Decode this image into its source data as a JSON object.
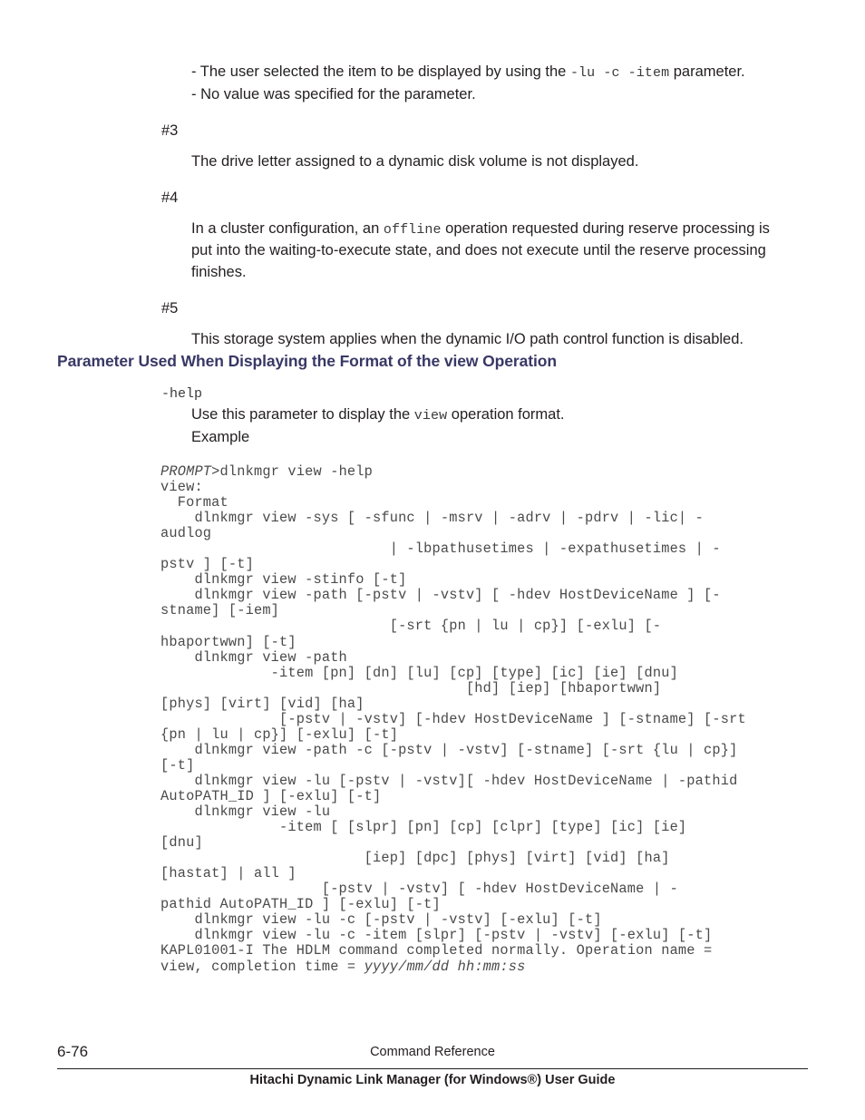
{
  "document": {
    "notes": [
      {
        "type": "bullet-group",
        "lines": [
          {
            "segments": [
              {
                "text": "- The user selected the item to be displayed by using the ",
                "mono": false
              },
              {
                "text": "-lu -c -item",
                "mono": true
              },
              {
                "text": " parameter.",
                "mono": false
              }
            ]
          },
          {
            "segments": [
              {
                "text": "- No value was specified for the parameter.",
                "mono": false
              }
            ]
          }
        ]
      },
      {
        "type": "note",
        "label": "#3",
        "lines": [
          {
            "segments": [
              {
                "text": "The drive letter assigned to a dynamic disk volume is not displayed.",
                "mono": false
              }
            ]
          }
        ]
      },
      {
        "type": "note",
        "label": "#4",
        "lines": [
          {
            "segments": [
              {
                "text": "In a cluster configuration, an ",
                "mono": false
              },
              {
                "text": "offline",
                "mono": true
              },
              {
                "text": " operation requested during reserve processing is put into the waiting-to-execute state, and does not execute until the reserve processing finishes.",
                "mono": false
              }
            ]
          }
        ]
      },
      {
        "type": "note",
        "label": "#5",
        "lines": [
          {
            "segments": [
              {
                "text": "This storage system applies when the dynamic I/O path control function is disabled.",
                "mono": false
              }
            ]
          }
        ]
      }
    ],
    "heading": {
      "before": "Parameter Used When Displaying the Format of the ",
      "keyword": "view",
      "after": " Operation",
      "color": "#383866"
    },
    "parameter": {
      "name": "-help",
      "description_before": "Use this parameter to display the ",
      "description_keyword": "view",
      "description_after": " operation format.",
      "example_label": "Example"
    },
    "code": {
      "prompt_italic": "PROMPT",
      "lines": "PROMPT>dlnkmgr view -help\nview:\n  Format\n    dlnkmgr view -sys [ -sfunc | -msrv | -adrv | -pdrv | -lic| -\naudlog\n                           | -lbpathusetimes | -expathusetimes | -\npstv ] [-t]\n    dlnkmgr view -stinfo [-t]\n    dlnkmgr view -path [-pstv | -vstv] [ -hdev HostDeviceName ] [-\nstname] [-iem]\n                           [-srt {pn | lu | cp}] [-exlu] [-\nhbaportwwn] [-t]\n    dlnkmgr view -path\n             -item [pn] [dn] [lu] [cp] [type] [ic] [ie] [dnu]\n                                    [hd] [iep] [hbaportwwn]\n[phys] [virt] [vid] [ha]\n              [-pstv | -vstv] [-hdev HostDeviceName ] [-stname] [-srt\n{pn | lu | cp}] [-exlu] [-t]\n    dlnkmgr view -path -c [-pstv | -vstv] [-stname] [-srt {lu | cp}]\n[-t]\n    dlnkmgr view -lu [-pstv | -vstv][ -hdev HostDeviceName | -pathid\nAutoPATH_ID ] [-exlu] [-t]\n    dlnkmgr view -lu\n              -item [ [slpr] [pn] [cp] [clpr] [type] [ic] [ie]\n[dnu]\n                        [iep] [dpc] [phys] [virt] [vid] [ha]\n[hastat] | all ]\n                   [-pstv | -vstv] [ -hdev HostDeviceName | -\npathid AutoPATH_ID ] [-exlu] [-t]\n    dlnkmgr view -lu -c [-pstv | -vstv] [-exlu] [-t]\n    dlnkmgr view -lu -c -item [slpr] [-pstv | -vstv] [-exlu] [-t]\nKAPL01001-I The HDLM command completed normally. Operation name =\nview, completion time = ",
      "trailing_italic": "yyyy/mm/dd hh:mm:ss"
    },
    "footer": {
      "page_number": "6-76",
      "chapter": "Command Reference",
      "guide_title": "Hitachi Dynamic Link Manager (for Windows®) User Guide"
    }
  }
}
